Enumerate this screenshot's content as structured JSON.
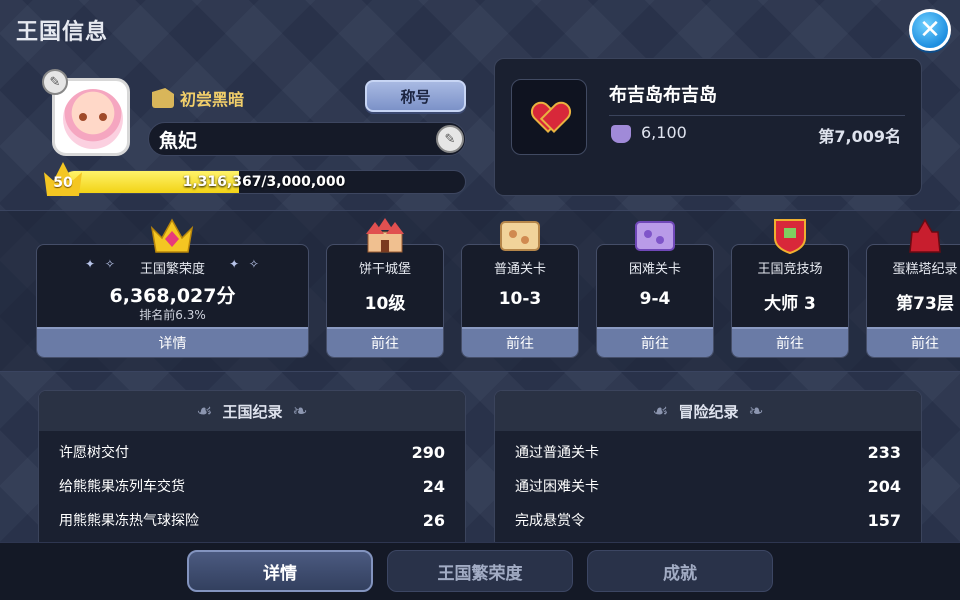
{
  "header": {
    "title": "王国信息",
    "close_label": "✕"
  },
  "profile": {
    "badge_title": "初尝黑暗",
    "title_button": "称号",
    "name": "魚妃",
    "level": "50",
    "xp_text": "1,316,367/3,000,000",
    "xp_fraction": 0.4388
  },
  "guild": {
    "name": "布吉岛布吉岛",
    "score": "6,100",
    "rank": "第7,009名"
  },
  "prosperity": {
    "label": "王国繁荣度",
    "value": "6,368,027分",
    "sub": "排名前6.3%",
    "button": "详情"
  },
  "cards": [
    {
      "label": "饼干城堡",
      "value": "10级",
      "button": "前往"
    },
    {
      "label": "普通关卡",
      "value": "10-3",
      "button": "前往"
    },
    {
      "label": "困难关卡",
      "value": "9-4",
      "button": "前往"
    },
    {
      "label": "王国竞技场",
      "value": "大师 3",
      "button": "前往"
    },
    {
      "label": "蛋糕塔纪录",
      "value": "第73层",
      "button": "前往"
    }
  ],
  "kingdom_record": {
    "title": "王国纪录",
    "rows": [
      {
        "label": "许愿树交付",
        "value": "290"
      },
      {
        "label": "给熊熊果冻列车交货",
        "value": "24"
      },
      {
        "label": "用熊熊果冻热气球探险",
        "value": "26"
      }
    ]
  },
  "adventure_record": {
    "title": "冒险纪录",
    "rows": [
      {
        "label": "通过普通关卡",
        "value": "233"
      },
      {
        "label": "通过困难关卡",
        "value": "204"
      },
      {
        "label": "完成悬赏令",
        "value": "157"
      }
    ]
  },
  "tabs": [
    {
      "label": "详情",
      "active": true
    },
    {
      "label": "王国繁荣度",
      "active": false
    },
    {
      "label": "成就",
      "active": false
    }
  ],
  "colors": {
    "accent": "#f4c622",
    "button": "#6a7ba6",
    "background": "#2c3650"
  }
}
